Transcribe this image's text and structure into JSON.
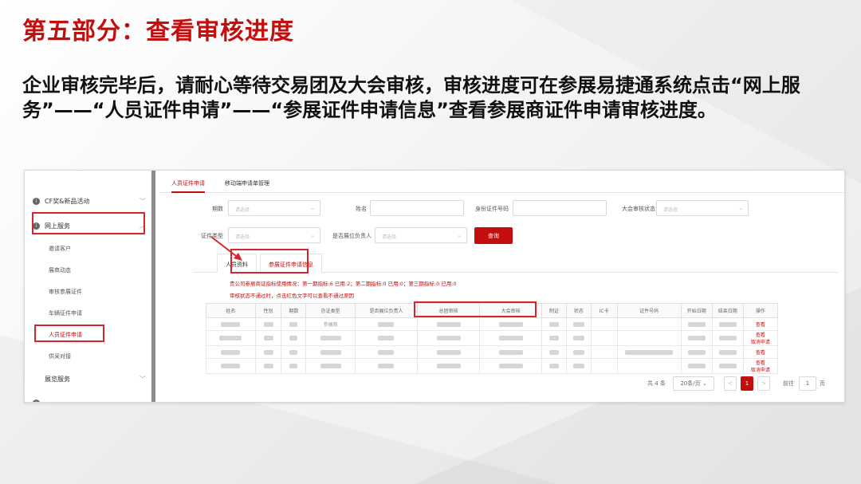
{
  "slide": {
    "title": "第五部分：查看审核进度",
    "description": "企业审核完毕后，请耐心等待交易团及大会审核，审核进度可在参展易捷通系统点击“网上服务”——“人员证件申请”——“参展证件申请信息”查看参展商证件申请审核进度。"
  },
  "sidebar": {
    "groups": [
      {
        "label": "CF奖&新品活动",
        "icon": "info-icon"
      },
      {
        "label": "网上服务",
        "icon": "info-icon"
      },
      {
        "label": "展览服务",
        "icon": ""
      }
    ],
    "items": [
      "邀请客户",
      "展商动态",
      "审核参展证件",
      "车辆证件申请",
      "人员证件申请",
      "供采对接"
    ]
  },
  "top_tabs": [
    "人员证件申请",
    "移动端申请单管理"
  ],
  "filters": {
    "period_label": "期数",
    "period_placeholder": "请选择",
    "name_label": "姓名",
    "id_label": "身份证件号码",
    "status_label": "大会审核状态",
    "status_placeholder": "请选择",
    "cert_type_label": "证件类型",
    "cert_type_placeholder": "请选择",
    "owner_label": "是否展位负责人",
    "owner_placeholder": "请选择",
    "query_button": "查询"
  },
  "sub_tabs": [
    "人员资料",
    "参展证件申请信息"
  ],
  "notes": {
    "quota": "贵公司参展商证指标使用情况：第一期指标:6 已用:2；第二期指标:0 已用:0；第三期指标:0 已用:0",
    "hint": "审核状态不通过时，点击红色文字可以查看不通过原因"
  },
  "table": {
    "headers": [
      "姓名",
      "性别",
      "期数",
      "办证类型",
      "是否展位负责人",
      "总团审核",
      "大会审核",
      "制证",
      "状态",
      "IC卡",
      "证件号码",
      "开始日期",
      "结束日期",
      "操作"
    ],
    "rows": [
      {
        "type": "参展商",
        "actions": [
          "查看"
        ]
      },
      {
        "type": "",
        "actions": [
          "查看",
          "取消申请"
        ]
      },
      {
        "type": "",
        "actions": [
          "查看"
        ]
      },
      {
        "type": "",
        "actions": [
          "查看",
          "取消申请"
        ]
      }
    ]
  },
  "pagination": {
    "total": "共 4 条",
    "page_size": "20条/页",
    "prev": "<",
    "current": "1",
    "next": ">",
    "goto_label": "前往",
    "goto_value": "1",
    "page_unit": "页"
  },
  "colors": {
    "accent": "#c40d0d",
    "highlight": "#d9232d"
  }
}
